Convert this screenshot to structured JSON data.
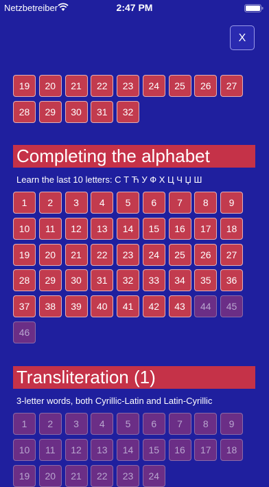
{
  "status_bar": {
    "carrier": "Netzbetreiber",
    "time": "2:47 PM"
  },
  "close_label": "X",
  "top_grid": {
    "tiles": [
      {
        "label": "19",
        "locked": false
      },
      {
        "label": "20",
        "locked": false
      },
      {
        "label": "21",
        "locked": false
      },
      {
        "label": "22",
        "locked": false
      },
      {
        "label": "23",
        "locked": false
      },
      {
        "label": "24",
        "locked": false
      },
      {
        "label": "25",
        "locked": false
      },
      {
        "label": "26",
        "locked": false
      },
      {
        "label": "27",
        "locked": false
      },
      {
        "label": "28",
        "locked": false
      },
      {
        "label": "29",
        "locked": false
      },
      {
        "label": "30",
        "locked": false
      },
      {
        "label": "31",
        "locked": false
      },
      {
        "label": "32",
        "locked": false
      }
    ]
  },
  "sections": [
    {
      "title": "Completing the alphabet",
      "subtitle": "Learn the last 10 letters: С Т Ћ У Ф Х Ц Ч Џ Ш",
      "tiles": [
        {
          "label": "1",
          "locked": false
        },
        {
          "label": "2",
          "locked": false
        },
        {
          "label": "3",
          "locked": false
        },
        {
          "label": "4",
          "locked": false
        },
        {
          "label": "5",
          "locked": false
        },
        {
          "label": "6",
          "locked": false
        },
        {
          "label": "7",
          "locked": false
        },
        {
          "label": "8",
          "locked": false
        },
        {
          "label": "9",
          "locked": false
        },
        {
          "label": "10",
          "locked": false
        },
        {
          "label": "11",
          "locked": false
        },
        {
          "label": "12",
          "locked": false
        },
        {
          "label": "13",
          "locked": false
        },
        {
          "label": "14",
          "locked": false
        },
        {
          "label": "15",
          "locked": false
        },
        {
          "label": "16",
          "locked": false
        },
        {
          "label": "17",
          "locked": false
        },
        {
          "label": "18",
          "locked": false
        },
        {
          "label": "19",
          "locked": false
        },
        {
          "label": "20",
          "locked": false
        },
        {
          "label": "21",
          "locked": false
        },
        {
          "label": "22",
          "locked": false
        },
        {
          "label": "23",
          "locked": false
        },
        {
          "label": "24",
          "locked": false
        },
        {
          "label": "25",
          "locked": false
        },
        {
          "label": "26",
          "locked": false
        },
        {
          "label": "27",
          "locked": false
        },
        {
          "label": "28",
          "locked": false
        },
        {
          "label": "29",
          "locked": false
        },
        {
          "label": "30",
          "locked": false
        },
        {
          "label": "31",
          "locked": false
        },
        {
          "label": "32",
          "locked": false
        },
        {
          "label": "33",
          "locked": false
        },
        {
          "label": "34",
          "locked": false
        },
        {
          "label": "35",
          "locked": false
        },
        {
          "label": "36",
          "locked": false
        },
        {
          "label": "37",
          "locked": false
        },
        {
          "label": "38",
          "locked": false
        },
        {
          "label": "39",
          "locked": false
        },
        {
          "label": "40",
          "locked": false
        },
        {
          "label": "41",
          "locked": false
        },
        {
          "label": "42",
          "locked": false
        },
        {
          "label": "43",
          "locked": false
        },
        {
          "label": "44",
          "locked": true
        },
        {
          "label": "45",
          "locked": true
        },
        {
          "label": "46",
          "locked": true
        }
      ]
    },
    {
      "title": "Transliteration (1)",
      "subtitle": "3-letter words, both Cyrillic-Latin and Latin-Cyrillic",
      "tiles": [
        {
          "label": "1",
          "locked": true
        },
        {
          "label": "2",
          "locked": true
        },
        {
          "label": "3",
          "locked": true
        },
        {
          "label": "4",
          "locked": true
        },
        {
          "label": "5",
          "locked": true
        },
        {
          "label": "6",
          "locked": true
        },
        {
          "label": "7",
          "locked": true
        },
        {
          "label": "8",
          "locked": true
        },
        {
          "label": "9",
          "locked": true
        },
        {
          "label": "10",
          "locked": true
        },
        {
          "label": "11",
          "locked": true
        },
        {
          "label": "12",
          "locked": true
        },
        {
          "label": "13",
          "locked": true
        },
        {
          "label": "14",
          "locked": true
        },
        {
          "label": "15",
          "locked": true
        },
        {
          "label": "16",
          "locked": true
        },
        {
          "label": "17",
          "locked": true
        },
        {
          "label": "18",
          "locked": true
        },
        {
          "label": "19",
          "locked": true
        },
        {
          "label": "20",
          "locked": true
        },
        {
          "label": "21",
          "locked": true
        },
        {
          "label": "22",
          "locked": true
        },
        {
          "label": "23",
          "locked": true
        },
        {
          "label": "24",
          "locked": true
        }
      ]
    }
  ]
}
